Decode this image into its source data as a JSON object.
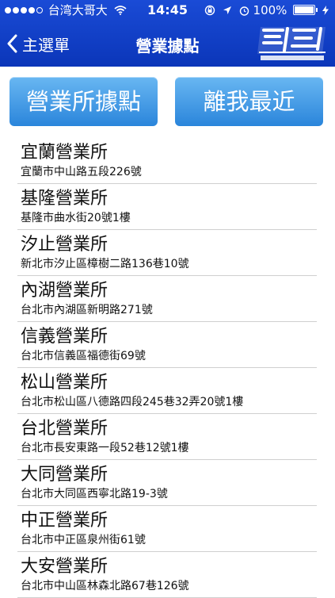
{
  "status_bar": {
    "carrier": "台湾大哥大",
    "time": "14:45",
    "battery": "100%"
  },
  "nav": {
    "back_label": "主選單",
    "title": "營業據點"
  },
  "buttons": {
    "offices": "營業所據點",
    "nearest": "離我最近"
  },
  "offices": [
    {
      "name": "宜蘭營業所",
      "address": "宜蘭市中山路五段226號"
    },
    {
      "name": "基隆營業所",
      "address": "基隆市曲水街20號1樓"
    },
    {
      "name": "汐止營業所",
      "address": "新北市汐止區樟樹二路136巷10號"
    },
    {
      "name": "內湖營業所",
      "address": "台北市內湖區新明路271號"
    },
    {
      "name": "信義營業所",
      "address": "台北市信義區福德街69號"
    },
    {
      "name": "松山營業所",
      "address": "台北市松山區八德路四段245巷32弄20號1樓"
    },
    {
      "name": "台北營業所",
      "address": "台北市長安東路一段52巷12號1樓"
    },
    {
      "name": "大同營業所",
      "address": "台北市大同區西寧北路19-3號"
    },
    {
      "name": "中正營業所",
      "address": "台北市中正區泉州街61號"
    },
    {
      "name": "大安營業所",
      "address": "台北市中山區林森北路67巷126號"
    }
  ],
  "colors": {
    "header": "#0b36b9",
    "button": "#2a85db"
  }
}
